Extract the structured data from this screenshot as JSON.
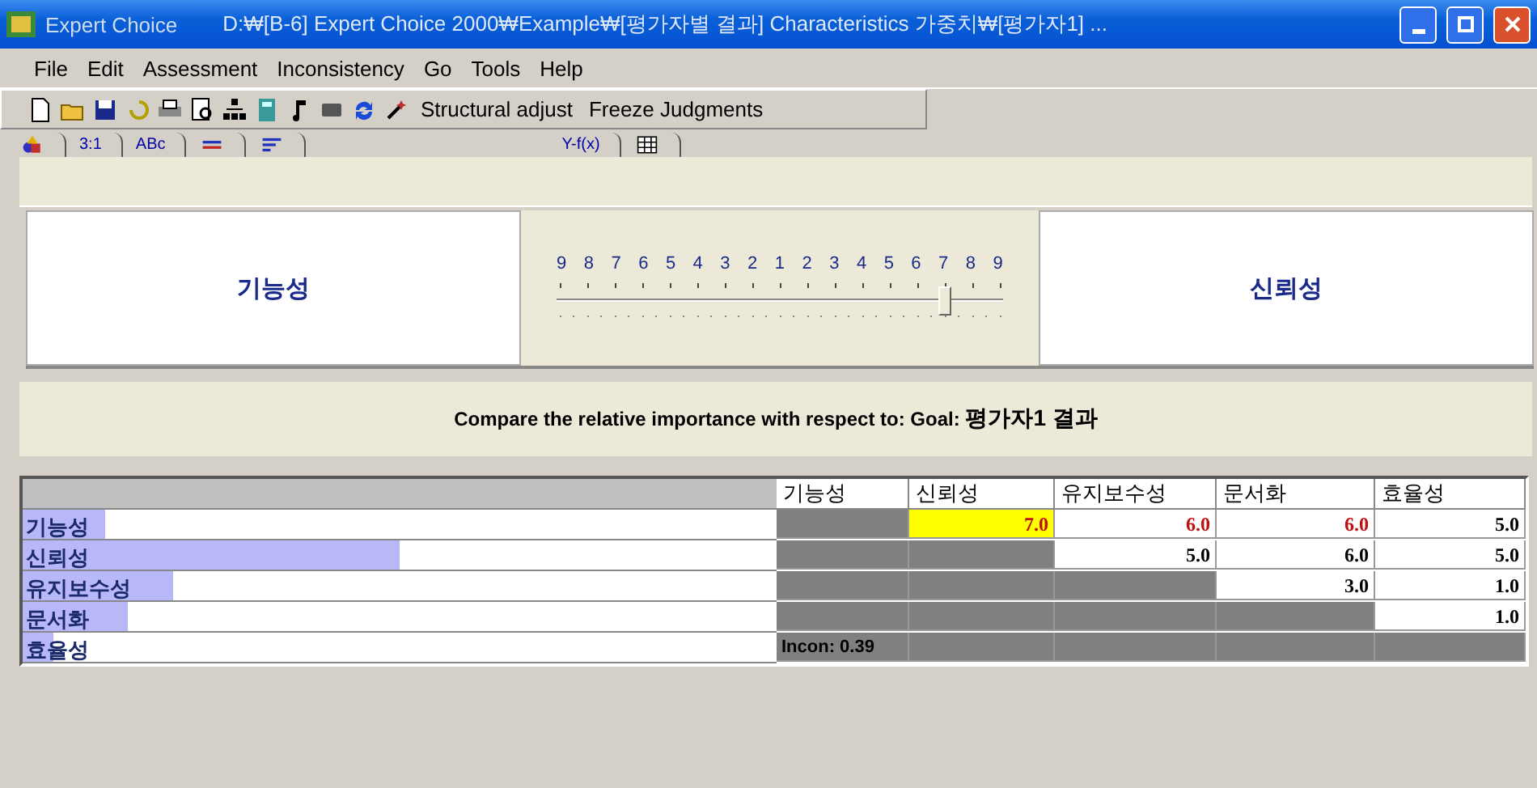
{
  "window": {
    "app": "Expert Choice",
    "title": "D:₩[B-6] Expert Choice 2000₩Example₩[평가자별 결과] Characteristics 가중치₩[평가자1] ..."
  },
  "menu": [
    "File",
    "Edit",
    "Assessment",
    "Inconsistency",
    "Go",
    "Tools",
    "Help"
  ],
  "toolbar": {
    "buttons": [
      "Structural adjust",
      "Freeze Judgments"
    ]
  },
  "tabs": [
    {
      "kind": "icon"
    },
    {
      "kind": "text",
      "label": "3:1"
    },
    {
      "kind": "text",
      "label": "ABc"
    },
    {
      "kind": "icon"
    },
    {
      "kind": "icon"
    },
    {
      "kind": "text",
      "label": "Y-f(x)"
    },
    {
      "kind": "icon"
    }
  ],
  "comparison": {
    "left": "기능성",
    "right": "신뢰성",
    "scale": [
      "9",
      "8",
      "7",
      "6",
      "5",
      "4",
      "3",
      "2",
      "1",
      "2",
      "3",
      "4",
      "5",
      "6",
      "7",
      "8",
      "9"
    ],
    "level": 0.875,
    "prompt_lead": "Compare the relative importance  with respect to: Goal:",
    "prompt_goal": "평가자1 결과"
  },
  "matrix": {
    "columns": [
      "기능성",
      "신뢰성",
      "유지보수성",
      "문서화",
      "효율성"
    ],
    "rows": [
      {
        "label": "기능성",
        "level": 0.11,
        "cells": [
          {
            "kind": "gray"
          },
          {
            "kind": "value",
            "text": "7.0",
            "inverse": true,
            "selected": true
          },
          {
            "kind": "value",
            "text": "6.0",
            "inverse": true,
            "selected": false
          },
          {
            "kind": "value",
            "text": "6.0",
            "inverse": true,
            "selected": false
          },
          {
            "kind": "value",
            "text": "5.0",
            "inverse": false,
            "selected": false
          }
        ]
      },
      {
        "label": "신뢰성",
        "level": 0.5,
        "cells": [
          {
            "kind": "gray"
          },
          {
            "kind": "gray"
          },
          {
            "kind": "value",
            "text": "5.0",
            "inverse": false,
            "selected": false
          },
          {
            "kind": "value",
            "text": "6.0",
            "inverse": false,
            "selected": false
          },
          {
            "kind": "value",
            "text": "5.0",
            "inverse": false,
            "selected": false
          }
        ]
      },
      {
        "label": "유지보수성",
        "level": 0.2,
        "cells": [
          {
            "kind": "gray"
          },
          {
            "kind": "gray"
          },
          {
            "kind": "gray"
          },
          {
            "kind": "value",
            "text": "3.0",
            "inverse": false,
            "selected": false
          },
          {
            "kind": "value",
            "text": "1.0",
            "inverse": false,
            "selected": false
          }
        ]
      },
      {
        "label": "문서화",
        "level": 0.14,
        "cells": [
          {
            "kind": "gray"
          },
          {
            "kind": "gray"
          },
          {
            "kind": "gray"
          },
          {
            "kind": "gray"
          },
          {
            "kind": "value",
            "text": "1.0",
            "inverse": false,
            "selected": false
          }
        ]
      },
      {
        "label": "효율성",
        "level": 0.04,
        "cells": [
          {
            "kind": "gray",
            "text": "Incon: 0.39"
          },
          {
            "kind": "gray"
          },
          {
            "kind": "gray"
          },
          {
            "kind": "gray"
          },
          {
            "kind": "gray"
          }
        ]
      }
    ]
  }
}
